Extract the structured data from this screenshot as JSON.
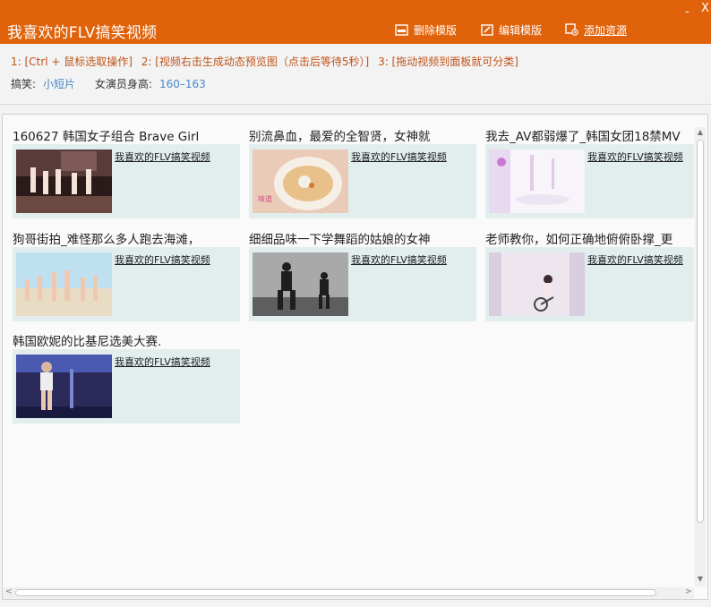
{
  "window": {
    "title": "我喜欢的FLV搞笑视频",
    "minimize": "-",
    "close": "X"
  },
  "toolbar": {
    "delete_label": "删除模版",
    "edit_label": "编辑模版",
    "add_label": "添加资源"
  },
  "instructions": {
    "step1": "1: [Ctrl + 鼠标选取操作]",
    "step2": "2: [视频右击生成动态预览图（点击后等待5秒）]",
    "step3": "3: [拖动视频到面板就可分类]"
  },
  "filters": {
    "category_label": "搞笑:",
    "category_value": "小短片",
    "height_label": "女演员身高:",
    "height_value": "160–163"
  },
  "videos": [
    {
      "title": "160627 韩国女子组合 Brave Girl",
      "link": "我喜欢的FLV搞笑视频",
      "thumb": "stage-dance"
    },
    {
      "title": "别流鼻血，最爱的全智贤，女神就",
      "link": "我喜欢的FLV搞笑视频",
      "thumb": "soup-bowl"
    },
    {
      "title": "我去_AV都弱爆了_韩国女团18禁MV",
      "link": "我喜欢的FLV搞笑视频",
      "thumb": "bright-room"
    },
    {
      "title": "狗哥街拍_难怪那么多人跑去海滩，",
      "link": "我喜欢的FLV搞笑视频",
      "thumb": "beach"
    },
    {
      "title": "细细品味一下学舞蹈的姑娘的女神",
      "link": "我喜欢的FLV搞笑视频",
      "thumb": "dance-studio"
    },
    {
      "title": "老师教你，如何正确地俯俯卧撑_更",
      "link": "我喜欢的FLV搞笑视频",
      "thumb": "gym-bike"
    },
    {
      "title": "韩国欧妮的比基尼选美大赛.",
      "link": "我喜欢的FLV搞笑视频",
      "thumb": "pageant"
    }
  ],
  "colors": {
    "titlebar": "#e0620a",
    "card_bg": "#e2eeee",
    "instruction": "#c0541a",
    "filter_value": "#4a87c8"
  }
}
